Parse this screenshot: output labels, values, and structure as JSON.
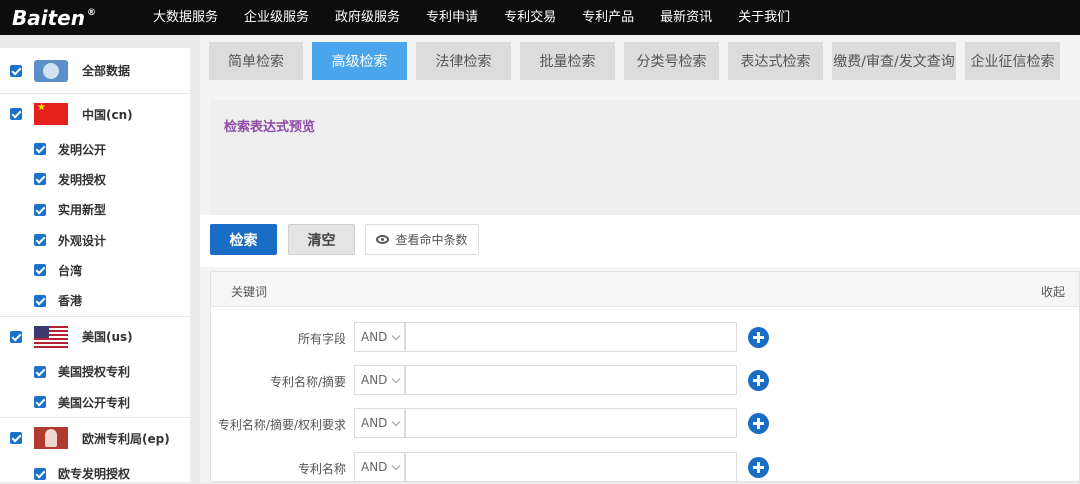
{
  "brand": {
    "logo_text": "Baiten",
    "logo_mark": "®"
  },
  "nav": {
    "items": [
      "大数据服务",
      "企业级服务",
      "政府级服务",
      "专利申请",
      "专利交易",
      "专利产品",
      "最新资讯",
      "关于我们"
    ]
  },
  "sidebar": {
    "groups": [
      {
        "label": "全部数据",
        "flag": "globe-icon",
        "items": []
      },
      {
        "label": "中国(cn)",
        "flag": "china-flag-icon",
        "items": [
          "发明公开",
          "发明授权",
          "实用新型",
          "外观设计",
          "台湾",
          "香港"
        ]
      },
      {
        "label": "美国(us)",
        "flag": "usa-flag-icon",
        "items": [
          "美国授权专利",
          "美国公开专利"
        ]
      },
      {
        "label": "欧洲专利局(ep)",
        "flag": "epo-logo-icon",
        "items": [
          "欧专发明授权"
        ]
      }
    ]
  },
  "tabs": [
    {
      "label": "简单检索",
      "active": false
    },
    {
      "label": "高级检索",
      "active": true
    },
    {
      "label": "法律检索",
      "active": false
    },
    {
      "label": "批量检索",
      "active": false
    },
    {
      "label": "分类号检索",
      "active": false
    },
    {
      "label": "表达式检索",
      "active": false
    },
    {
      "label": "缴费/审查/发文查询",
      "active": false
    },
    {
      "label": "企业征信检索",
      "active": false
    }
  ],
  "preview": {
    "label": "检索表达式预览"
  },
  "actions": {
    "search": "检索",
    "clear": "清空",
    "hits": "查看命中条数"
  },
  "form": {
    "title": "关键词",
    "collapse": "收起",
    "rows": [
      {
        "label": "所有字段",
        "op": "AND",
        "value": ""
      },
      {
        "label": "专利名称/摘要",
        "op": "AND",
        "value": ""
      },
      {
        "label": "专利名称/摘要/权利要求",
        "op": "AND",
        "value": ""
      },
      {
        "label": "专利名称",
        "op": "AND",
        "value": ""
      }
    ]
  },
  "colors": {
    "topbar": "#0d0d0d",
    "accent": "#1a6dc4",
    "active_tab": "#4aa6ec",
    "preview_label": "#8e4ca8"
  }
}
